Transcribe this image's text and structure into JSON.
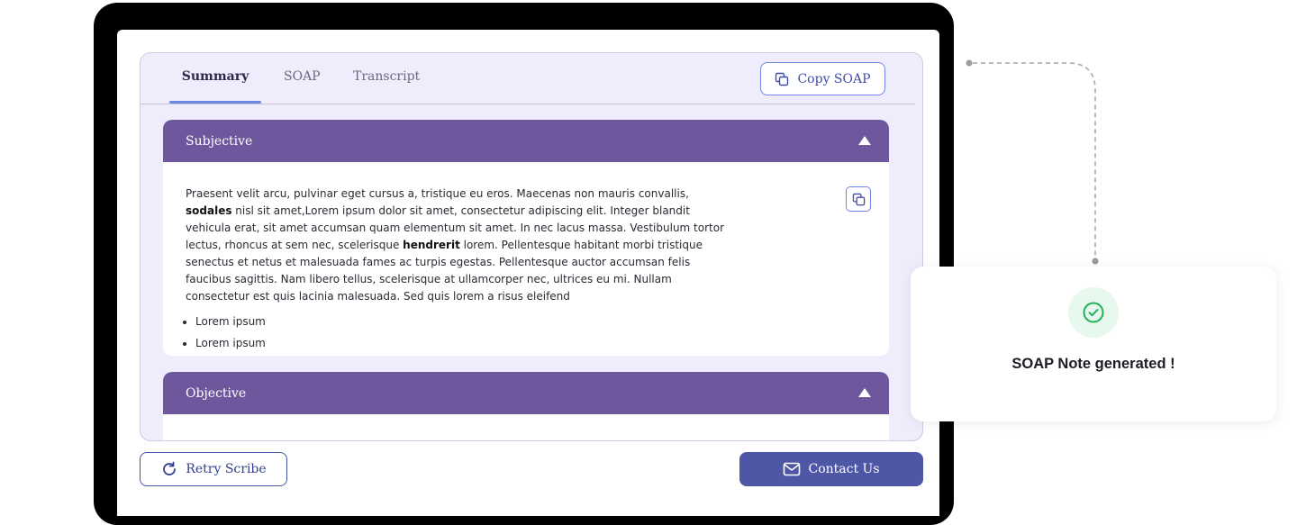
{
  "tabs": [
    {
      "label": "Summary",
      "active": true
    },
    {
      "label": "SOAP",
      "active": false
    },
    {
      "label": "Transcript",
      "active": false
    }
  ],
  "toolbar": {
    "copy_soap_label": "Copy SOAP",
    "copy_icon": "copy-icon"
  },
  "sections": [
    {
      "title": "Subjective",
      "expanded": true,
      "paragraph": {
        "part1": "Praesent velit arcu, pulvinar eget cursus a, tristique eu eros. Maecenas non mauris convallis, ",
        "bold1": "sodales",
        "part2": " nisl sit amet,Lorem ipsum dolor sit amet, consectetur adipiscing elit. Integer blandit vehicula erat, sit amet accumsan quam elementum sit amet. In nec lacus massa. Vestibulum tortor lectus, rhoncus at sem nec, scelerisque ",
        "bold2": "hendrerit",
        "part3": " lorem. Pellentesque habitant morbi tristique senectus et netus et malesuada fames ac turpis egestas. Pellentesque auctor accumsan felis faucibus sagittis. Nam libero tellus, scelerisque at ullamcorper nec, ultrices eu mi. Nullam consectetur est quis lacinia malesuada. Sed quis lorem a risus eleifend"
      },
      "bullets": [
        "Lorem ipsum",
        "Lorem ipsum"
      ]
    },
    {
      "title": "Objective",
      "expanded": true
    }
  ],
  "footer": {
    "retry_label": "Retry Scribe",
    "contact_label": "Contact Us"
  },
  "toast": {
    "message": "SOAP Note generated !",
    "icon": "check-circle-icon"
  },
  "colors": {
    "section_header": "#6f579d",
    "panel_bg": "#efecfb",
    "accent": "#6e86e6",
    "primary_button": "#4e56a6",
    "success": "#22b05a"
  }
}
